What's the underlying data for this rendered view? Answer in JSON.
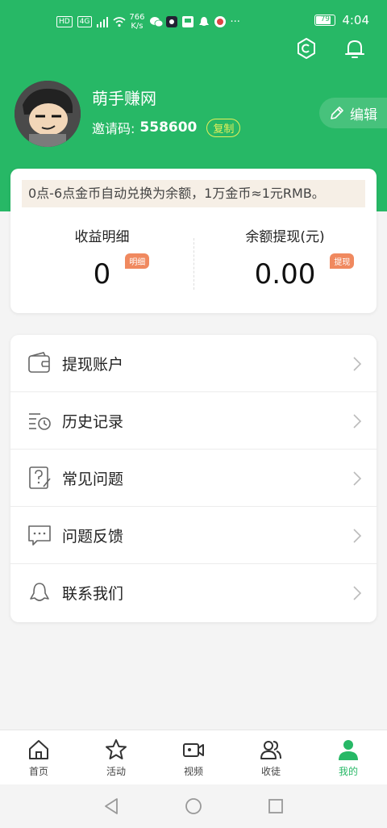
{
  "status_bar": {
    "left_badges": [
      "HD",
      "4G"
    ],
    "speed_value": "766",
    "speed_unit": "K/s",
    "battery": "79",
    "time": "4:04"
  },
  "profile": {
    "username": "萌手赚网",
    "invite_label": "邀请码:",
    "invite_code": "558600",
    "copy_label": "复制",
    "edit_label": "编辑"
  },
  "earnings": {
    "notice": "0点-6点金币自动兑换为余额，1万金币≈1元RMB。",
    "income_label": "收益明细",
    "income_value": "0",
    "income_tag": "明细",
    "balance_label": "余额提现(元)",
    "balance_value": "0.00",
    "balance_tag": "提现"
  },
  "menu": {
    "items": [
      {
        "label": "提现账户",
        "icon": "wallet-icon"
      },
      {
        "label": "历史记录",
        "icon": "history-icon"
      },
      {
        "label": "常见问题",
        "icon": "faq-icon"
      },
      {
        "label": "问题反馈",
        "icon": "feedback-icon"
      },
      {
        "label": "联系我们",
        "icon": "qq-icon"
      }
    ]
  },
  "bottom_nav": {
    "items": [
      {
        "label": "首页",
        "icon": "home-icon"
      },
      {
        "label": "活动",
        "icon": "star-icon"
      },
      {
        "label": "视频",
        "icon": "video-icon"
      },
      {
        "label": "收徒",
        "icon": "users-icon"
      },
      {
        "label": "我的",
        "icon": "person-icon",
        "active": true
      }
    ]
  },
  "colors": {
    "brand": "#27b866",
    "tag": "#f0895f",
    "copy_badge": "#e6ef5a"
  }
}
